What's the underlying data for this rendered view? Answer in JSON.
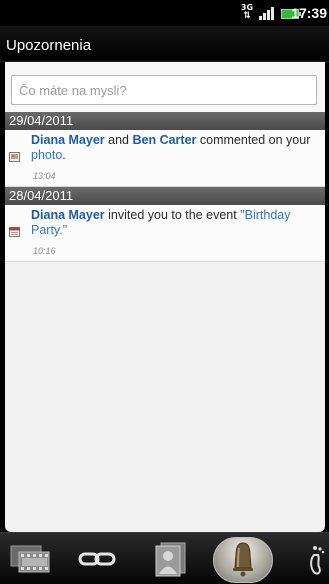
{
  "status_bar": {
    "network": "3G",
    "clock": "17:39",
    "colors": {
      "battery": "#2ec12e"
    }
  },
  "header": {
    "title": "Upozornenia"
  },
  "search": {
    "placeholder": "Čo máte na mysli?"
  },
  "groups": [
    {
      "date": "29/04/2011",
      "items": [
        {
          "actor1": "Diana Mayer",
          "joiner": "and",
          "actor2": "Ben Carter",
          "action": "commented on your",
          "object": "photo",
          "end": ".",
          "time": "13:04",
          "icon": "photo-comment-icon"
        }
      ]
    },
    {
      "date": "28/04/2011",
      "items": [
        {
          "actor1": "Diana Mayer",
          "action": "invited you to the event",
          "object": "\"Birthday Party.\"",
          "time": "10:16",
          "icon": "calendar-event-icon"
        }
      ]
    }
  ],
  "tabs": [
    {
      "name": "updates-tab",
      "icon": "film-strip-icon"
    },
    {
      "name": "links-tab",
      "icon": "chain-link-icon"
    },
    {
      "name": "contacts-tab",
      "icon": "contact-card-icon"
    },
    {
      "name": "notifications-tab",
      "icon": "bell-icon",
      "selected": true
    },
    {
      "name": "footprints-tab",
      "icon": "footprint-icon"
    }
  ],
  "colors": {
    "accent_name": "#1b5ea8",
    "accent_link": "#2f77c4",
    "separator": "#5a5a5a",
    "panel_bg": "#f2f2f2"
  }
}
